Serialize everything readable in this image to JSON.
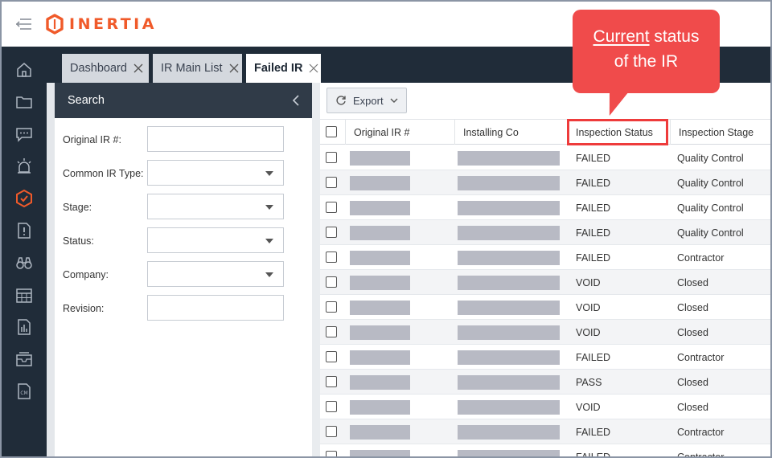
{
  "app": {
    "logo_text": "INERTIA",
    "brand_color": "#f05a2a",
    "nav_color": "#202c39"
  },
  "topbar": {
    "menu_icon": "collapse-menu-icon"
  },
  "leftnav": {
    "items": [
      {
        "icon": "home-icon"
      },
      {
        "icon": "folder-icon"
      },
      {
        "icon": "chat-icon"
      },
      {
        "icon": "alarm-icon"
      },
      {
        "icon": "inspection-icon",
        "active": true
      },
      {
        "icon": "alert-document-icon"
      },
      {
        "icon": "binoculars-icon"
      },
      {
        "icon": "calendar-icon"
      },
      {
        "icon": "report-icon"
      },
      {
        "icon": "inbox-icon"
      },
      {
        "icon": "cm-document-icon"
      }
    ]
  },
  "tabs": [
    {
      "label": "Dashboard",
      "active": false,
      "closable": true
    },
    {
      "label": "IR Main List",
      "active": false,
      "closable": true
    },
    {
      "label": "Failed IR",
      "active": true,
      "closable": true
    }
  ],
  "search": {
    "title": "Search",
    "fields": [
      {
        "label": "Original IR #:",
        "type": "text",
        "value": ""
      },
      {
        "label": "Common IR Type:",
        "type": "select",
        "value": ""
      },
      {
        "label": "Stage:",
        "type": "select",
        "value": ""
      },
      {
        "label": "Status:",
        "type": "select",
        "value": ""
      },
      {
        "label": "Company:",
        "type": "select",
        "value": ""
      },
      {
        "label": "Revision:",
        "type": "text",
        "value": ""
      }
    ]
  },
  "toolbar": {
    "export_label": "Export"
  },
  "table": {
    "columns": [
      "Original IR #",
      "Installing Co",
      "Inspection Status",
      "Inspection Stage"
    ],
    "rows": [
      {
        "status": "FAILED",
        "stage": "Quality Control"
      },
      {
        "status": "FAILED",
        "stage": "Quality Control"
      },
      {
        "status": "FAILED",
        "stage": "Quality Control"
      },
      {
        "status": "FAILED",
        "stage": "Quality Control"
      },
      {
        "status": "FAILED",
        "stage": "Contractor"
      },
      {
        "status": "VOID",
        "stage": "Closed"
      },
      {
        "status": "VOID",
        "stage": "Closed"
      },
      {
        "status": "VOID",
        "stage": "Closed"
      },
      {
        "status": "FAILED",
        "stage": "Contractor"
      },
      {
        "status": "PASS",
        "stage": "Closed"
      },
      {
        "status": "VOID",
        "stage": "Closed"
      },
      {
        "status": "FAILED",
        "stage": "Contractor"
      },
      {
        "status": "FAILED",
        "stage": "Contractor"
      }
    ]
  },
  "annotation": {
    "line1_underlined": "Current",
    "line1_rest": " status",
    "line2": "of the IR",
    "color": "#f04b4b"
  }
}
